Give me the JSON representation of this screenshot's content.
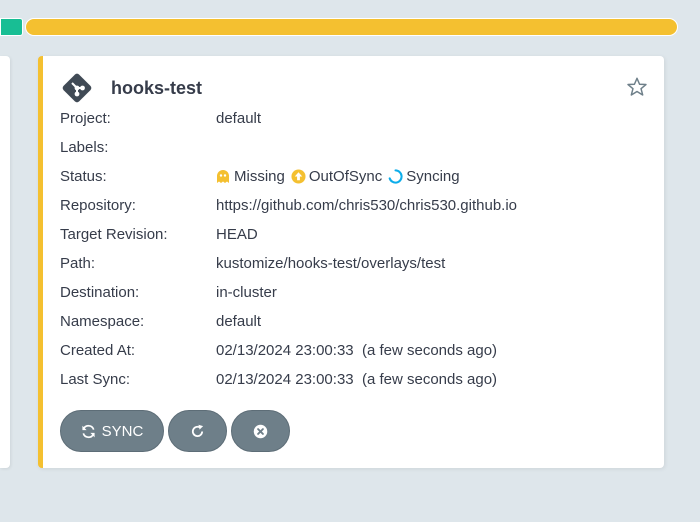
{
  "app": {
    "name": "hooks-test",
    "fields": [
      {
        "label": "Project:",
        "value": "default"
      },
      {
        "label": "Labels:",
        "value": ""
      },
      {
        "label": "Status:",
        "value": ""
      },
      {
        "label": "Repository:",
        "value": "https://github.com/chris530/chris530.github.io"
      },
      {
        "label": "Target Revision:",
        "value": "HEAD"
      },
      {
        "label": "Path:",
        "value": "kustomize/hooks-test/overlays/test"
      },
      {
        "label": "Destination:",
        "value": "in-cluster"
      },
      {
        "label": "Namespace:",
        "value": "default"
      },
      {
        "label": "Created At:",
        "value": "02/13/2024 23:00:33  (a few seconds ago)"
      },
      {
        "label": "Last Sync:",
        "value": "02/13/2024 23:00:33  (a few seconds ago)"
      }
    ],
    "status": {
      "health": "Missing",
      "sync": "OutOfSync",
      "operation": "Syncing"
    }
  },
  "buttons": {
    "sync_label": "SYNC"
  },
  "icons": {
    "app": "git-icon",
    "favorite": "star-icon",
    "health": "ghost-icon",
    "sync": "arrow-up-circle-icon",
    "operation": "spinner-icon",
    "sync_button": "sync-icon",
    "refresh_button": "refresh-icon",
    "delete_button": "close-circle-icon"
  },
  "colors": {
    "accent_yellow": "#f4c030",
    "synced_green": "#18be94",
    "operation_blue": "#0dadea",
    "button_gray": "#6e7f89",
    "text": "#363c4a",
    "background": "#dee6eb"
  }
}
